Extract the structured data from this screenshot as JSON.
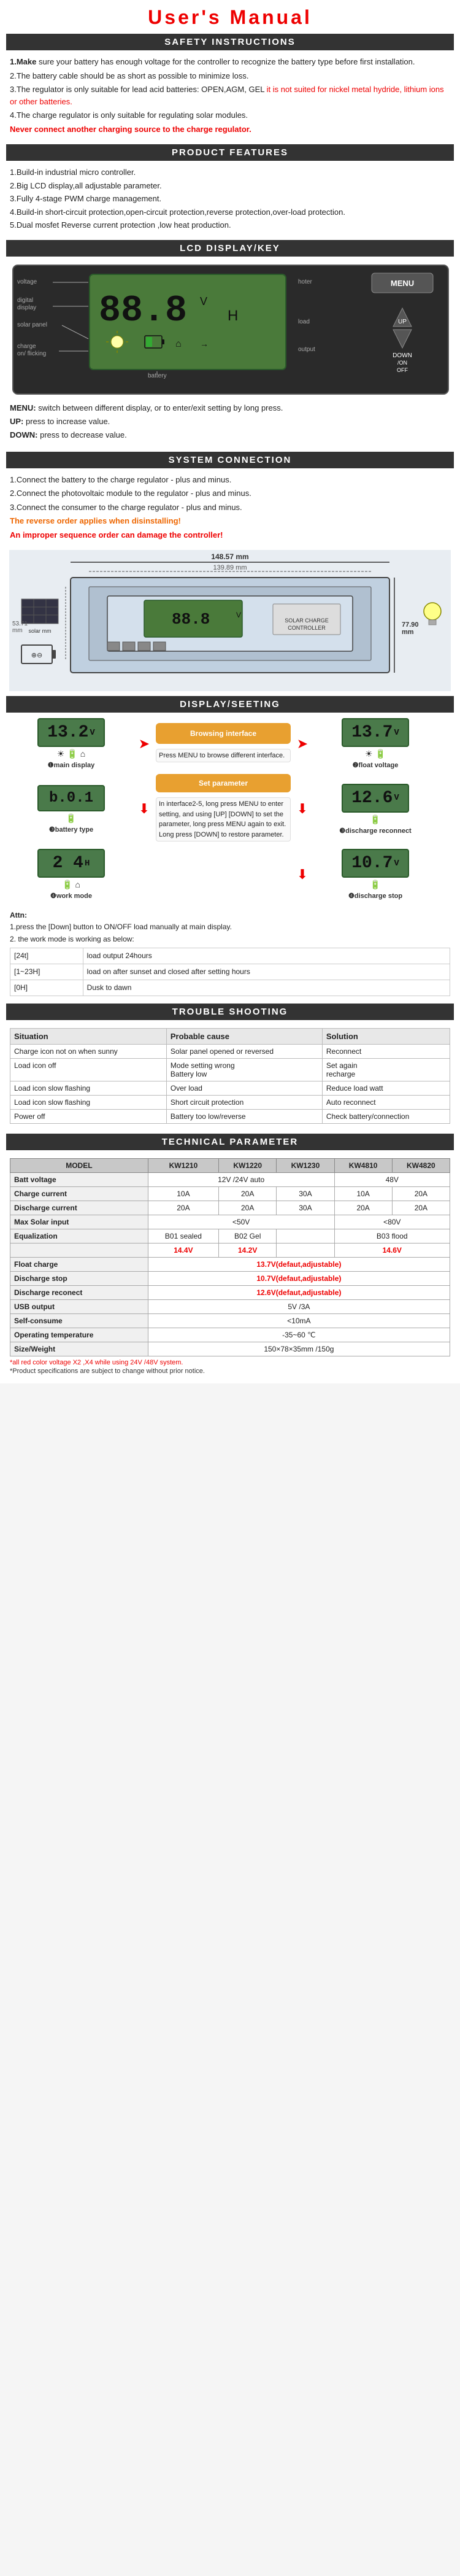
{
  "title": "User's   Manual",
  "sections": {
    "safety": {
      "header": "SAFETY INSTRUCTIONS",
      "items": [
        "1.Make sure your battery has enough voltage for the controller to recognize the battery type before first installation.",
        "2.The battery cable should be as short as possible to minimize loss.",
        "3.The regulator is only suitable for lead acid batteries: OPEN,AGM, GEL it is not suited for nickel metal hydride, lithium ions or other batteries.",
        "4.The charge regulator is only suitable for regulating solar modules.",
        "Never connect another charging source to the charge regulator."
      ]
    },
    "features": {
      "header": "PRODUCT FEATURES",
      "items": [
        "1.Build-in industrial micro controller.",
        "2.Big LCD display,all adjustable parameter.",
        "3.Fully 4-stage PWM charge management.",
        "4.Build-in short-circuit protection,open-circuit protection,reverse protection,over-load protection.",
        "5.Dual mosfet Reverse current protection ,low heat production."
      ]
    },
    "lcd": {
      "header": "LCD DISPLAY/KEY",
      "display_num": "88.8",
      "display_unit": "V",
      "display_sub": "H",
      "labels_left": [
        "voltage",
        "digital display",
        "solar panel",
        "charge on/ flicking"
      ],
      "labels_right_top": [
        "hoter",
        "load",
        "output"
      ],
      "labels_bottom": [
        "battery"
      ],
      "buttons": [
        "MENU",
        "UP",
        "DOWN/ON/OFF"
      ],
      "key_desc": [
        "MENU: switch between different display, or to enter/exit setting by long press.",
        "UP:   press to increase value.",
        "DOWN: press to decrease value."
      ]
    },
    "system_connection": {
      "header": "SYSTEM CONNECTION",
      "items": [
        "1.Connect the battery to the charge regulator - plus and minus.",
        "2.Connect the photovoltaic module to the regulator - plus and minus.",
        "3.Connect the consumer to the charge regulator - plus and minus."
      ],
      "note1": "The reverse order applies when disinstalling!",
      "note2": "An improper sequence order can damage the controller!"
    },
    "dimensions": {
      "outer": "148.57 mm",
      "inner": "139.89 mm",
      "height_outer": "77.90 mm",
      "height_inner": "53.71 mm"
    },
    "display_setting": {
      "header": "DISPLAY/SEETING",
      "main_display": "13.2",
      "main_unit": "V",
      "main_label": "❶main display",
      "float_voltage": "13.7",
      "float_unit": "V",
      "float_label": "❷float voltage",
      "battery_type": "b.0.1",
      "battery_label": "❸battery type",
      "discharge_reconnect": "12.6",
      "discharge_reconnect_unit": "V",
      "discharge_reconnect_label": "❸discharge reconnect",
      "work_mode": "2 4",
      "work_mode_unit": "H",
      "work_mode_label": "❹work mode",
      "discharge_stop": "10.7",
      "discharge_stop_unit": "V",
      "discharge_stop_label": "❹discharge stop",
      "browse_title": "Browsing interface",
      "browse_instr": "Press MENU to browse different interface.",
      "set_title": "Set parameter",
      "set_instr": "In interface2-5, long press MENU to enter setting, and using [UP] [DOWN] to set the parameter, long press MENU again to exit. Long press [DOWN] to restore parameter."
    },
    "attn": {
      "title": "Attn:",
      "items": [
        "1.press the [Down] button to ON/OFF load manually at main display.",
        "2. the work mode is working as below:"
      ],
      "table": [
        [
          "[24t]",
          "load output 24hours"
        ],
        [
          "[1~23H]",
          "load on after sunset and closed after setting hours"
        ],
        [
          "[0H]",
          "Dusk to dawn"
        ]
      ]
    },
    "trouble": {
      "header": "TROUBLE SHOOTING",
      "columns": [
        "Situation",
        "Probable cause",
        "Solution"
      ],
      "rows": [
        [
          "Charge icon not on when sunny",
          "Solar panel opened or reversed",
          "Reconnect"
        ],
        [
          "Load icon off",
          "Mode setting wrong\nBattery low",
          "Set again\nrecharge"
        ],
        [
          "Load icon slow flashing",
          "Over load",
          "Reduce load watt"
        ],
        [
          "Load icon slow flashing",
          "Short circuit protection",
          "Auto reconnect"
        ],
        [
          "Power off",
          "Battery too low/reverse",
          "Check battery/connection"
        ]
      ]
    },
    "technical": {
      "header": "TECHNICAL PARAMETER",
      "columns": [
        "MODEL",
        "KW1210",
        "KW1220",
        "KW1230",
        "KW4810",
        "KW4820"
      ],
      "rows": [
        {
          "label": "Batt voltage",
          "values": [
            "12V /24V auto",
            "",
            "",
            "48V",
            ""
          ]
        },
        {
          "label": "Charge current",
          "values": [
            "10A",
            "20A",
            "30A",
            "10A",
            "20A"
          ]
        },
        {
          "label": "Discharge current",
          "values": [
            "20A",
            "20A",
            "30A",
            "20A",
            "20A"
          ]
        },
        {
          "label": "Max Solar input",
          "values": [
            "<50V",
            "",
            "",
            "<80V",
            ""
          ]
        },
        {
          "label": "Equalization",
          "values": [
            "B01 sealed  14.4V",
            "B02 Gel  14.2V",
            "",
            "B03 flood  14.6V",
            ""
          ]
        },
        {
          "label": "Float charge",
          "values": [
            "13.7V(defaut,adjustable)",
            "",
            "",
            "",
            ""
          ]
        },
        {
          "label": "Discharge stop",
          "values": [
            "10.7V(defaut,adjustable)",
            "",
            "",
            "",
            ""
          ]
        },
        {
          "label": "Discharge reconect",
          "values": [
            "12.6V(defaut,adjustable)",
            "",
            "",
            "",
            ""
          ]
        },
        {
          "label": "USB output",
          "values": [
            "5V /3A",
            "",
            "",
            "",
            ""
          ]
        },
        {
          "label": "Self-consume",
          "values": [
            "<10mA",
            "",
            "",
            "",
            ""
          ]
        },
        {
          "label": "Operating temperature",
          "values": [
            "-35~60 ℃",
            "",
            "",
            "",
            ""
          ]
        },
        {
          "label": "Size/Weight",
          "values": [
            "150×78×35mm /150g",
            "",
            "",
            "",
            ""
          ]
        }
      ],
      "footnote1": "*all red color voltage X2 ,X4 while using 24V /48V system.",
      "footnote2": "*Product specifications are subject to change without prior notice."
    }
  }
}
